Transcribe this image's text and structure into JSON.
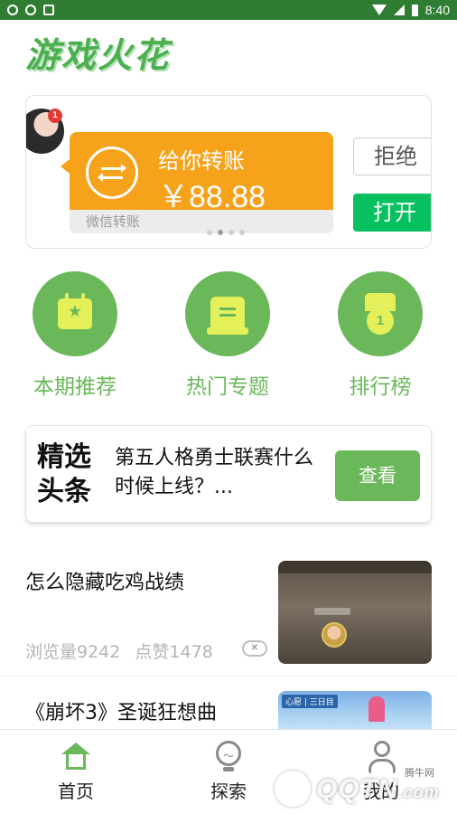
{
  "status_bar": {
    "time": "8:40",
    "left_icons": [
      "sync-icon",
      "sync-icon",
      "image-icon"
    ],
    "right_icons": [
      "wifi-icon",
      "cell-signal-icon",
      "battery-icon"
    ]
  },
  "app": {
    "title": "游戏火花",
    "brand_color": "#6ab85a"
  },
  "banner": {
    "avatar_badge": "1",
    "transfer_title": "给你转账",
    "transfer_amount": "￥88.88",
    "transfer_footer": "微信转账",
    "reject_label": "拒绝",
    "open_label": "打开",
    "carousel_pages": 4,
    "carousel_active": 1,
    "card_color": "#f7a21b",
    "open_color": "#07c160"
  },
  "quick_entries": [
    {
      "label": "本期推荐",
      "icon": "calendar-star-icon"
    },
    {
      "label": "热门专题",
      "icon": "document-icon"
    },
    {
      "label": "排行榜",
      "icon": "medal-icon",
      "icon_text": "1"
    }
  ],
  "headline": {
    "tag_line1": "精选",
    "tag_line2": "头条",
    "text": "第五人格勇士联赛什么时候上线？...",
    "button_label": "查看"
  },
  "articles": [
    {
      "title": "怎么隐藏吃鸡战绩",
      "views": "浏览量9242",
      "likes": "点赞1478"
    },
    {
      "title": "《崩坏3》圣诞狂想曲",
      "thumb_badge": "心愿 | 三日目"
    }
  ],
  "tabbar": {
    "tabs": [
      {
        "label": "首页",
        "icon": "home-icon",
        "active": true
      },
      {
        "label": "探索",
        "icon": "lightbulb-icon",
        "active": false
      },
      {
        "label": "我的",
        "icon": "user-icon",
        "active": false
      }
    ]
  },
  "watermark": {
    "brand": "QQTN",
    "suffix": ".com",
    "small": "腾牛网"
  }
}
